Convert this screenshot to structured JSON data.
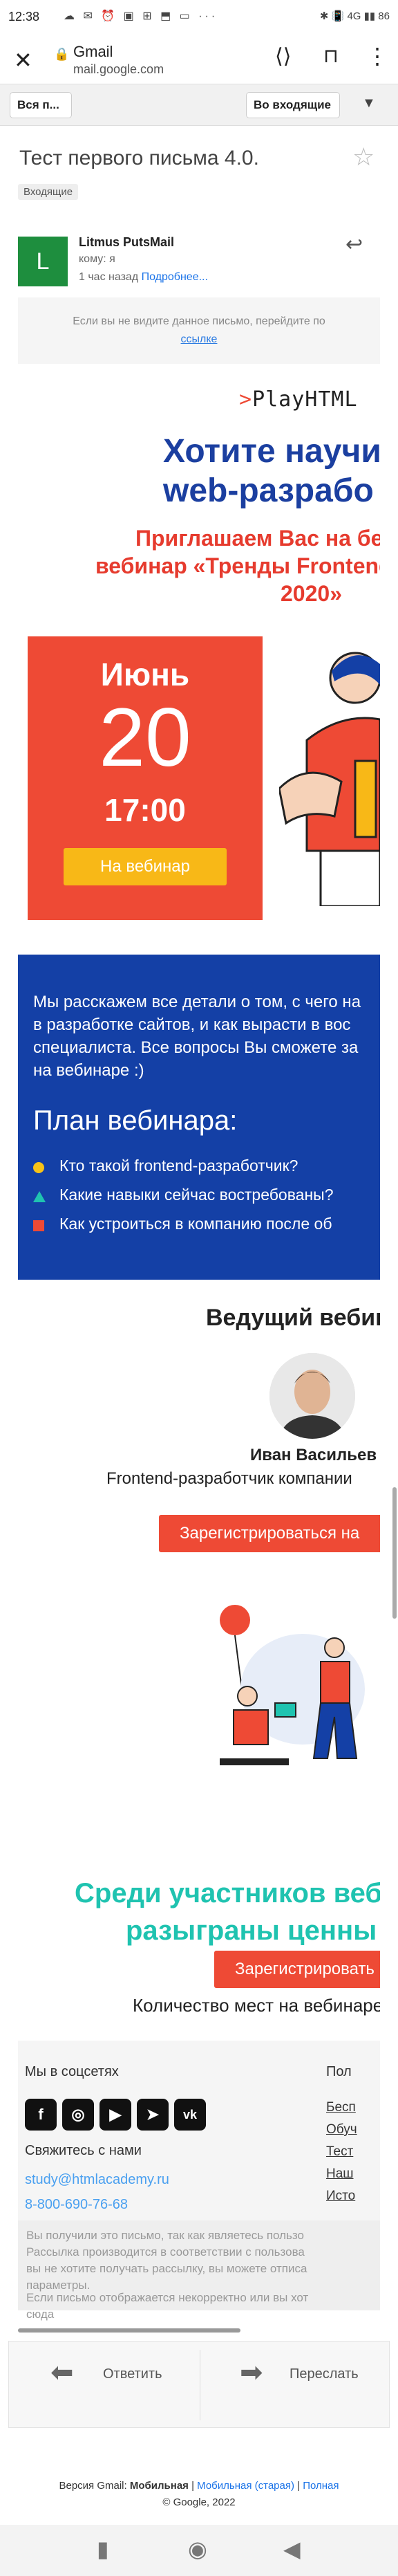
{
  "status_bar": {
    "time": "12:38",
    "icons": "☁ ✉ ⏰ ▣ ⊞ ⬒ ▭ ···",
    "right": "✱ 📳 4G ▮▮ 86"
  },
  "browser": {
    "title": "Gmail",
    "url": "mail.google.com"
  },
  "gmail_toolbar": {
    "folder_button": "Вся п...",
    "inbox_button": "Во входящие"
  },
  "message": {
    "subject": "Тест первого письма 4.0.",
    "label": "Входящие",
    "avatar_letter": "L",
    "sender": "Litmus PutsMail",
    "to": "кому: я",
    "time": "1 час назад",
    "details_link": "Подробнее..."
  },
  "email": {
    "preheader_text": "Если вы не видите данное письмо, перейдите по",
    "preheader_link": "ссылке",
    "logo": "PlayHTML",
    "headline_line1": "Хотите научи",
    "headline_line2": "web-разрабо",
    "invite_line1": "Приглашаем Вас на бе",
    "invite_line2": "вебинар «Тренды Frontend",
    "invite_line3": "2020»",
    "date_month": "Июнь",
    "date_day": "20",
    "date_time": "17:00",
    "date_button": "На вебинар",
    "intro_line1": "Мы расскажем все детали о том, с чего на",
    "intro_line2": "в разработке сайтов, и как вырасти в вос",
    "intro_line3": "специалиста. Все вопросы Вы сможете за",
    "intro_line4": "на вебинаре :)",
    "plan_title": "План вебинара:",
    "plan_items": [
      {
        "text": "Кто такой frontend-разработчик?",
        "color": "#f8c317"
      },
      {
        "text": "Какие навыки сейчас востребованы?",
        "color": "#1fc3b0"
      },
      {
        "text": "Как устроиться в компанию после об",
        "color": "#ee4a35"
      }
    ],
    "host_title": "Ведущий вебин",
    "host_name": "Иван Васильев",
    "host_role": "Frontend-разработчик компании",
    "register_button_1": "Зарегистрироваться на",
    "participants_line1": "Среди участников веб",
    "participants_line2": "разыграны ценны",
    "register_button_2": "Зарегистрировать",
    "seats_text": "Количество мест на вебинаре",
    "footer": {
      "social_title": "Мы в соцсетях",
      "policy_title": "Пол",
      "contact_title": "Свяжитесь с нами",
      "email": "study@htmlacademy.ru",
      "phone": "8-800-690-76-68",
      "policy_links": [
        "Бесп",
        "Обуч",
        "Тест",
        "Наш",
        "Исто"
      ],
      "social_icons": [
        "f",
        "◎",
        "▶",
        "➤",
        "vk"
      ]
    },
    "disclaimer_line1": "Вы получили это письмо, так как являетесь пользо",
    "disclaimer_line2": "Рассылка производится в соответствии с пользова",
    "disclaimer_line3": "вы не хотите получать рассылку, вы можете отписа",
    "disclaimer_line4": "параметры.",
    "disclaimer_line5": "Если письмо отображается некорректно или вы хот",
    "disclaimer_line6": "сюда"
  },
  "actions": {
    "reply": "Ответить",
    "forward": "Переслать"
  },
  "bottom": {
    "version_prefix": "Версия Gmail:",
    "version_current": "Мобильная",
    "version_old": "Мобильная (старая)",
    "version_full": "Полная",
    "copyright": "© Google, 2022"
  }
}
